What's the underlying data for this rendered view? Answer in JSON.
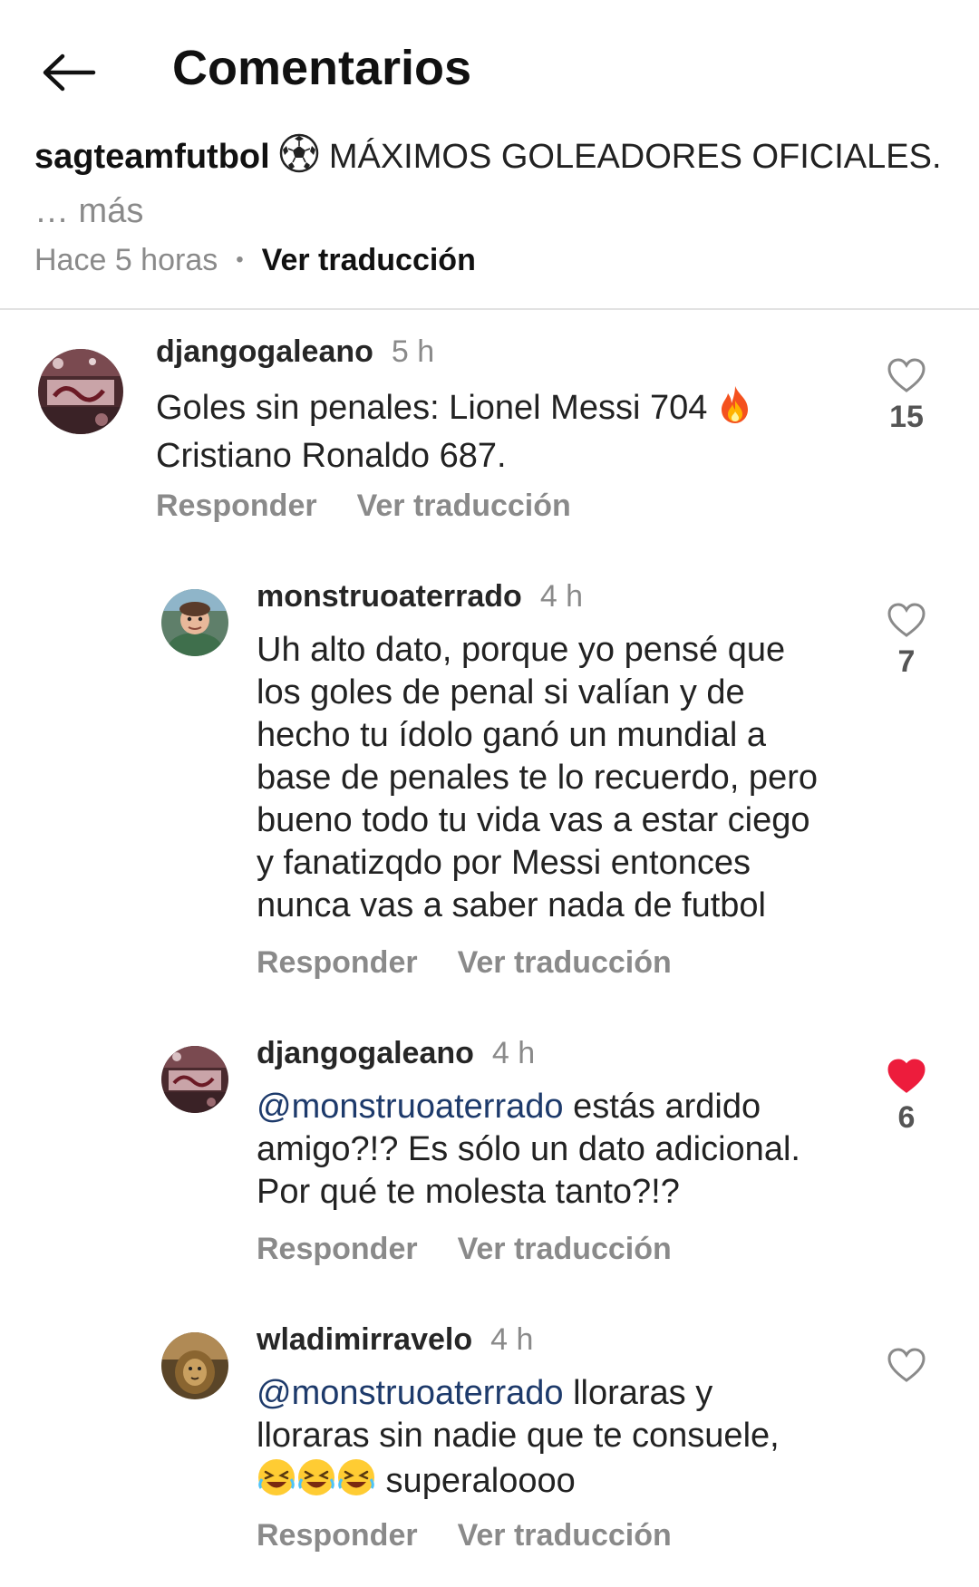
{
  "header": {
    "title": "Comentarios"
  },
  "post": {
    "author": "sagteamfutbol",
    "caption": "MÁXIMOS GOLEADORES OFICIALES.",
    "more": "… más",
    "time": "Hace 5 horas",
    "translate": "Ver traducción"
  },
  "comments": [
    {
      "user": "djangogaleano",
      "time": "5 h",
      "text_before": "Goles sin penales: Lionel Messi 704",
      "text_after": "Cristiano Ronaldo 687.",
      "reply": "Responder",
      "translate": "Ver traducción",
      "likes": "15",
      "liked": false
    },
    {
      "user": "monstruoaterrado",
      "time": "4 h",
      "lines": [
        "Uh alto dato, porque yo pensé que",
        "los goles de penal si valían y de",
        "hecho tu ídolo ganó un mundial a",
        "base de penales te lo recuerdo, pero",
        "bueno todo tu vida vas a estar ciego",
        "y fanatizqdo por Messi entonces",
        "nunca vas a saber nada de futbol"
      ],
      "reply": "Responder",
      "translate": "Ver traducción",
      "likes": "7",
      "liked": false
    },
    {
      "user": "djangogaleano",
      "time": "4 h",
      "mention": "@monstruoaterrado",
      "line1_rest": " estás ardido",
      "line2": "amigo?!? Es sólo un dato adicional.",
      "line3": "Por qué te molesta tanto?!?",
      "reply": "Responder",
      "translate": "Ver traducción",
      "likes": "6",
      "liked": true
    },
    {
      "user": "wladimirravelo",
      "time": "4 h",
      "mention": "@monstruoaterrado",
      "line1_rest": " lloraras y",
      "line2": "lloraras sin nadie que te consuele,",
      "line3_rest": " superaloooo",
      "reply": "Responder",
      "translate": "Ver traducción",
      "likes": "",
      "liked": false
    }
  ],
  "colors": {
    "like_red": "#ed1c3c",
    "mention_blue": "#1d3a6b",
    "muted_gray": "#8a8a8a",
    "divider": "#e2e2e2"
  },
  "icons": {
    "back": "back-arrow-icon",
    "like": "heart-outline-icon",
    "liked": "heart-filled-icon",
    "soccer": "soccer-ball-emoji",
    "fire": "fire-emoji",
    "laugh": "rolling-laughing-emoji"
  }
}
